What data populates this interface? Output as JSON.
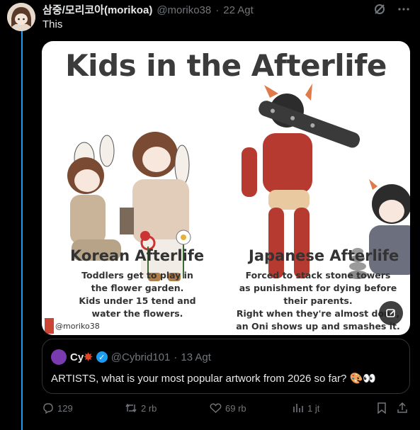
{
  "tweet": {
    "author_name": "삼중/모리코아(morikoa)",
    "handle": "@moriko38",
    "separator": "·",
    "date": "22 Agt",
    "text": "This"
  },
  "media": {
    "title": "Kids in the Afterlife",
    "left_title": "Korean Afterlife",
    "left_body": [
      "Toddlers get to play in",
      "the flower garden.",
      "Kids under 15 tend and",
      "water the flowers."
    ],
    "right_title": "Japanese Afterlife",
    "right_body": [
      "Forced to stack stone towers",
      "as punishment for dying before",
      "their parents.",
      "Right when they're almost done,",
      "an Oni shows up and smashes it."
    ],
    "credit": "@moriko38"
  },
  "quote": {
    "author_name": "Cy",
    "handle": "@Cybrid101",
    "separator": "·",
    "date": "13 Agt",
    "text": "ARTISTS, what is your most popular artwork from 2026 so far? 🎨👀"
  },
  "actions": {
    "replies": "129",
    "reposts": "2 rb",
    "likes": "69 rb",
    "views": "1 jt"
  },
  "colors": {
    "accent": "#1d9bf0",
    "muted": "#71767b",
    "background": "#000000"
  }
}
